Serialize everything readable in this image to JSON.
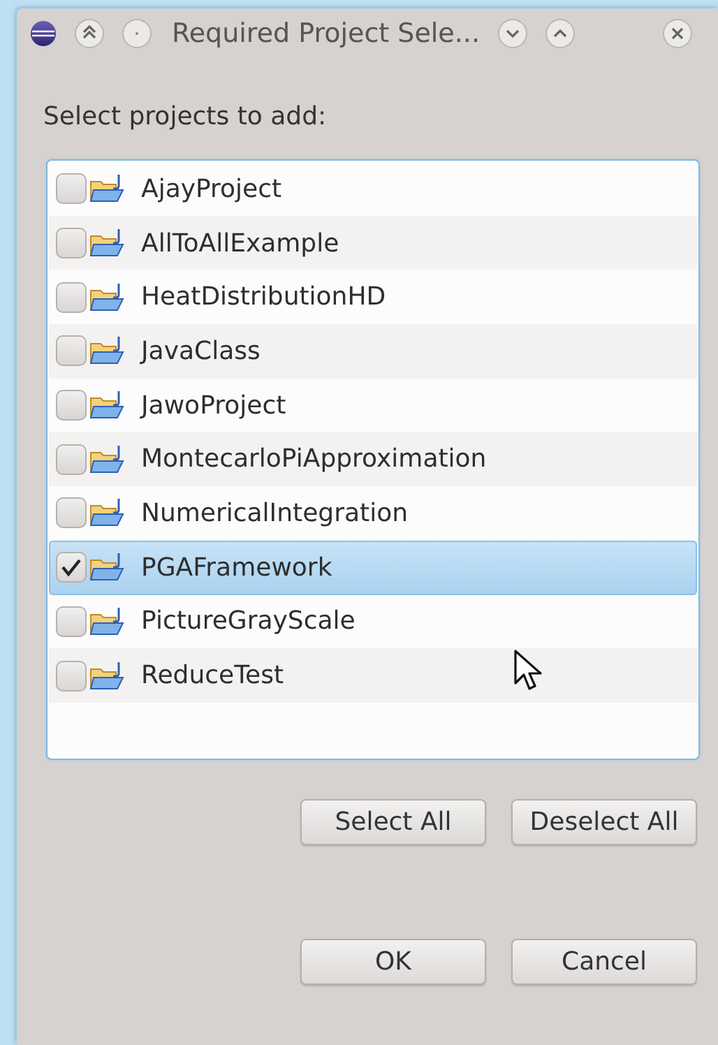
{
  "window": {
    "title": "Required Project Sele..."
  },
  "prompt": "Select projects to add:",
  "projects": [
    {
      "name": "AjayProject",
      "checked": false,
      "selected": false
    },
    {
      "name": "AllToAllExample",
      "checked": false,
      "selected": false
    },
    {
      "name": "HeatDistributionHD",
      "checked": false,
      "selected": false
    },
    {
      "name": "JavaClass",
      "checked": false,
      "selected": false
    },
    {
      "name": "JawoProject",
      "checked": false,
      "selected": false
    },
    {
      "name": "MontecarloPiApproximation",
      "checked": false,
      "selected": false
    },
    {
      "name": "NumericalIntegration",
      "checked": false,
      "selected": false
    },
    {
      "name": "PGAFramework",
      "checked": true,
      "selected": true
    },
    {
      "name": "PictureGrayScale",
      "checked": false,
      "selected": false
    },
    {
      "name": "ReduceTest",
      "checked": false,
      "selected": false
    }
  ],
  "selection_buttons": [
    "Select All",
    "Deselect All"
  ],
  "dialog_buttons": [
    "OK",
    "Cancel"
  ]
}
